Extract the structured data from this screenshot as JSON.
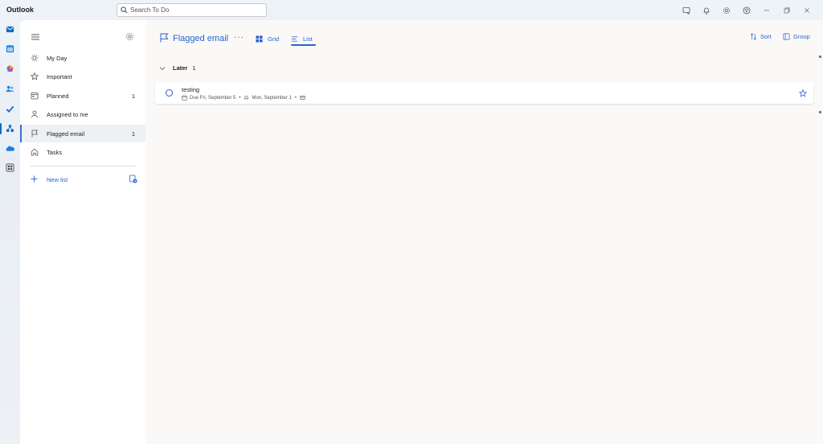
{
  "app": {
    "title": "Outlook"
  },
  "search": {
    "placeholder": "Search To Do"
  },
  "titlebar_icons": [
    "feedback-icon",
    "bell-icon",
    "gear-icon",
    "copilot-icon",
    "minimize-icon",
    "restore-icon",
    "close-icon"
  ],
  "rail": {
    "items": [
      "mail-icon",
      "calendar-icon",
      "copilot-icon",
      "people-icon",
      "todo-icon",
      "org-explorer-icon",
      "onedrive-icon",
      "more-apps-icon"
    ],
    "active": "todo-icon"
  },
  "sidebar": {
    "items": [
      {
        "label": "My Day",
        "icon": "sun-icon",
        "count": ""
      },
      {
        "label": "Important",
        "icon": "star-icon",
        "count": ""
      },
      {
        "label": "Planned",
        "icon": "calendar-icon",
        "count": "1"
      },
      {
        "label": "Assigned to me",
        "icon": "person-icon",
        "count": ""
      },
      {
        "label": "Flagged email",
        "icon": "flag-icon",
        "count": "1"
      },
      {
        "label": "Tasks",
        "icon": "home-icon",
        "count": ""
      }
    ],
    "selected": "Flagged email",
    "new_list_label": "New list"
  },
  "main": {
    "title": "Flagged email",
    "more_label": "···",
    "views": {
      "grid": "Grid",
      "list": "List",
      "active": "List"
    },
    "sort_label": "Sort",
    "group_label": "Group",
    "section": {
      "label": "Later",
      "count": "1"
    },
    "tasks": [
      {
        "title": "testing",
        "due": "Due Fri, September 5",
        "reminder": "Mon, September 1",
        "sep": "•"
      }
    ]
  },
  "colors": {
    "accent": "#2564cf",
    "selected_bg": "#eef0f3",
    "main_bg": "#faf9f8"
  }
}
